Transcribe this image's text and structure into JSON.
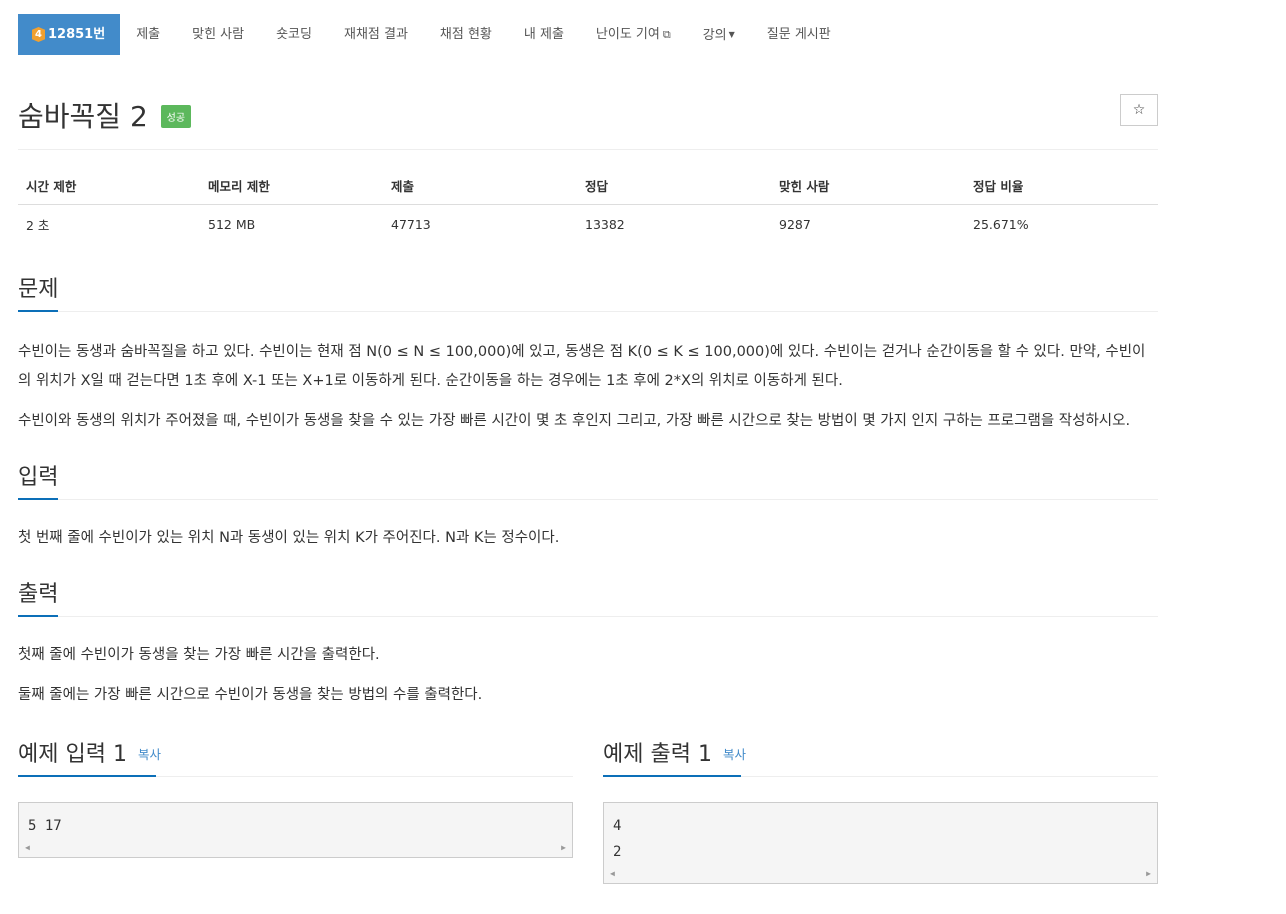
{
  "nav": {
    "problem_tier": "4",
    "problem_number": "12851번",
    "items": [
      "제출",
      "맞힌 사람",
      "숏코딩",
      "재채점 결과",
      "채점 현황",
      "내 제출",
      "난이도 기여",
      "강의",
      "질문 게시판"
    ]
  },
  "title": {
    "text": "숨바꼭질 2",
    "badge": "성공",
    "star": "☆"
  },
  "info": {
    "headers": [
      "시간 제한",
      "메모리 제한",
      "제출",
      "정답",
      "맞힌 사람",
      "정답 비율"
    ],
    "values": [
      "2 초",
      "512 MB",
      "47713",
      "13382",
      "9287",
      "25.671%"
    ]
  },
  "problem": {
    "heading": "문제",
    "paragraphs": [
      "수빈이는 동생과 숨바꼭질을 하고 있다. 수빈이는 현재 점 N(0 ≤ N ≤ 100,000)에 있고, 동생은 점 K(0 ≤ K ≤ 100,000)에 있다. 수빈이는 걷거나 순간이동을 할 수 있다. 만약, 수빈이의 위치가 X일 때 걷는다면 1초 후에 X-1 또는 X+1로 이동하게 된다. 순간이동을 하는 경우에는 1초 후에 2*X의 위치로 이동하게 된다.",
      "수빈이와 동생의 위치가 주어졌을 때, 수빈이가 동생을 찾을 수 있는 가장 빠른 시간이 몇 초 후인지 그리고, 가장 빠른 시간으로 찾는 방법이 몇 가지 인지 구하는 프로그램을 작성하시오."
    ]
  },
  "input": {
    "heading": "입력",
    "text": "첫 번째 줄에 수빈이가 있는 위치 N과 동생이 있는 위치 K가 주어진다. N과 K는 정수이다."
  },
  "output": {
    "heading": "출력",
    "paragraphs": [
      "첫째 줄에 수빈이가 동생을 찾는 가장 빠른 시간을 출력한다.",
      "둘째 줄에는 가장 빠른 시간으로 수빈이가 동생을 찾는 방법의 수를 출력한다."
    ]
  },
  "sample_input": {
    "heading": "예제 입력 1",
    "copy": "복사",
    "lines": [
      "5 17"
    ]
  },
  "sample_output": {
    "heading": "예제 출력 1",
    "copy": "복사",
    "lines": [
      "4",
      "2"
    ]
  },
  "colors": {
    "nav_active": "#428bca",
    "badge_success": "#5cb85c",
    "section_underline": "#0c6fb8",
    "tier_gold": "#f0a030"
  }
}
